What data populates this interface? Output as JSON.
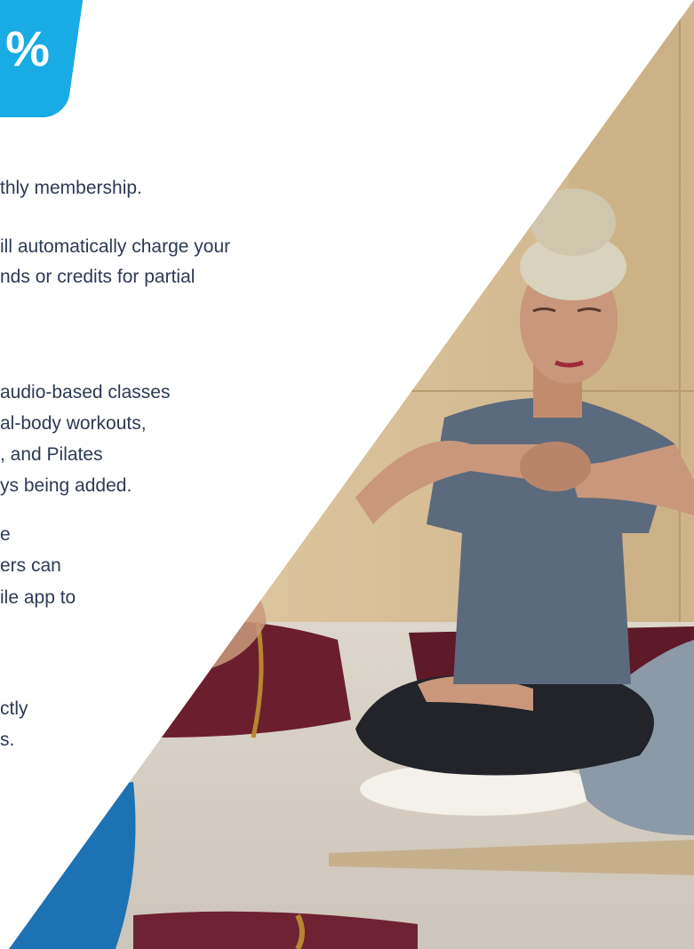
{
  "promo": {
    "badge_text": "%"
  },
  "content": {
    "lines": [
      "thly membership.",
      "ill automatically charge your",
      "nds or credits for partial",
      "audio-based classes",
      "al-body workouts,",
      ", and Pilates",
      "ys being added.",
      "e",
      "ers can",
      "ile app to",
      "ctly",
      "s."
    ]
  },
  "photo": {
    "subject": "yoga-meditation-class"
  },
  "colors": {
    "accent": "#19abe4",
    "text": "#2d3a55",
    "wall": "#d9bf98",
    "floor": "#d6d0c6"
  }
}
